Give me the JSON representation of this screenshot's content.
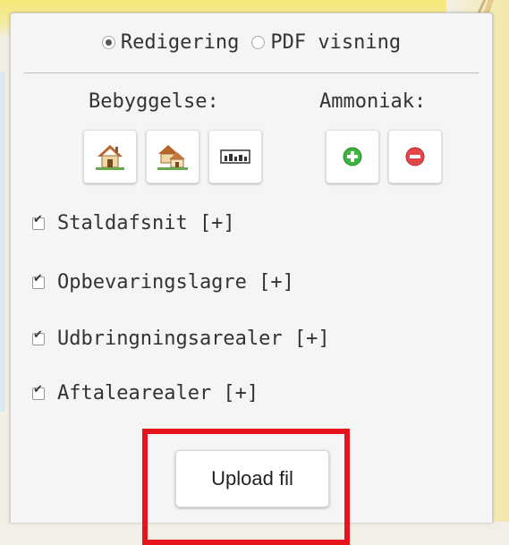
{
  "mode": {
    "options": [
      {
        "label": "Redigering",
        "selected": true
      },
      {
        "label": "PDF visning",
        "selected": false
      }
    ]
  },
  "groups": {
    "bebyggelse_label": "Bebyggelse:",
    "ammoniak_label": "Ammoniak:"
  },
  "icons": {
    "bebyggelse": [
      "house-icon",
      "houses-icon",
      "buildings-row-icon"
    ],
    "ammoniak": [
      "add-icon",
      "remove-icon"
    ],
    "colors": {
      "add": "#3cb53f",
      "remove": "#e3454b",
      "highlight": "#e8141d"
    }
  },
  "layers": [
    {
      "label": "Staldafsnit [+]",
      "checked": true
    },
    {
      "label": "Opbevaringslagre [+]",
      "checked": true
    },
    {
      "label": "Udbringningsarealer [+]",
      "checked": true
    },
    {
      "label": "Aftalearealer [+]",
      "checked": true
    }
  ],
  "upload": {
    "label": "Upload fil"
  }
}
